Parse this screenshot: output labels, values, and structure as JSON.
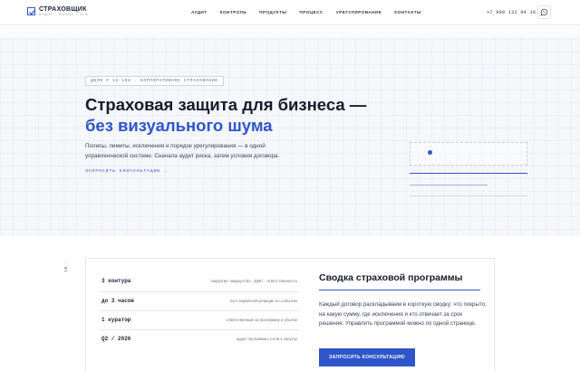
{
  "brand": {
    "name": "СТРАХОВЩИК",
    "tagline": "АУДИТ · ПОЛИС · SLA"
  },
  "nav": [
    "АУДИТ",
    "КОНТРОЛЬ",
    "ПРОДУКТЫ",
    "ПРОЦЕСС",
    "УРЕГУЛИРОВАНИЕ",
    "КОНТАКТЫ"
  ],
  "header": {
    "phone": "+7 900 132 04 16",
    "whatsapp_icon": "whatsapp-icon"
  },
  "hero": {
    "tag": "ДБЛ9 # 1К-108 · КОРПОРАТИВНОЕ СТРАХОВАНИЕ",
    "title_line1": "Страховая защита для бизнеса —",
    "title_line2": "без визуального шума",
    "lead": "Полисы, лимиты, исключения и порядок урегулирования — в одной управленческой системе. Сначала аудит риска, затем условия договора.",
    "cta": "ЗАПРОСИТЬ КОНСУЛЬТАЦИЮ →"
  },
  "section2": {
    "side_number": "10 ·",
    "stats": [
      {
        "value": "3 контура",
        "desc": "покрытие: имущество · ДМС · ответственность"
      },
      {
        "value": "до 3 часов",
        "desc": "SLA первичной реакции по событию"
      },
      {
        "value": "1 куратор",
        "desc": "ответственный за программу и убытки"
      },
      {
        "value": "Q2 / 2026",
        "desc": "аудит программы готов к запуску"
      }
    ],
    "summary_title": "Сводка страховой программы",
    "summary_text": "Каждый договор раскладываем в короткую сводку: что покрыто, на какую сумму, где исключения и кто отвечает за срок решения. Управлять программой можно по одной странице.",
    "summary_button": "ЗАПРОСИТЬ КОНСУЛЬТАЦИЮ"
  },
  "colors": {
    "accent": "#2f56c8",
    "text": "#151c2b",
    "muted": "#6b7488"
  }
}
